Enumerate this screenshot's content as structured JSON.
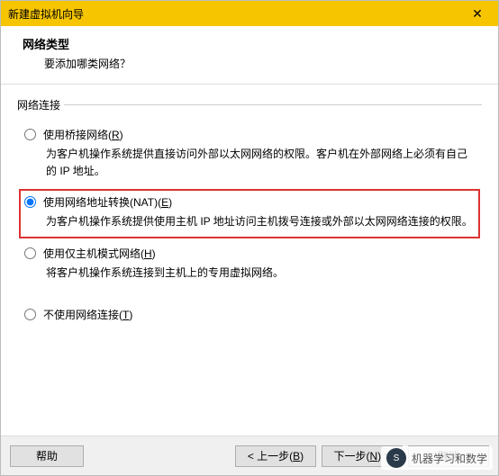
{
  "titlebar": {
    "title": "新建虚拟机向导",
    "close_glyph": "✕"
  },
  "header": {
    "heading": "网络类型",
    "sub": "要添加哪类网络？"
  },
  "group": {
    "legend": "网络连接"
  },
  "options": {
    "bridge": {
      "label_pre": "使用桥接网络(",
      "label_key": "R",
      "label_post": ")",
      "desc": "为客户机操作系统提供直接访问外部以太网网络的权限。客户机在外部网络上必须有自己的 IP 地址。"
    },
    "nat": {
      "label_pre": "使用网络地址转换(NAT)(",
      "label_key": "E",
      "label_post": ")",
      "desc": "为客户机操作系统提供使用主机 IP 地址访问主机拨号连接或外部以太网网络连接的权限。"
    },
    "hostonly": {
      "label_pre": "使用仅主机模式网络(",
      "label_key": "H",
      "label_post": ")",
      "desc": "将客户机操作系统连接到主机上的专用虚拟网络。"
    },
    "none": {
      "label_pre": "不使用网络连接(",
      "label_key": "T",
      "label_post": ")"
    }
  },
  "footer": {
    "help": "帮助",
    "back_pre": "< 上一步(",
    "back_key": "B",
    "back_post": ")",
    "next_pre": "下一步(",
    "next_key": "N",
    "next_post": ") >",
    "cancel": "取消"
  },
  "watermark": {
    "text": "机器学习和数学",
    "avatar_glyph": "S"
  }
}
